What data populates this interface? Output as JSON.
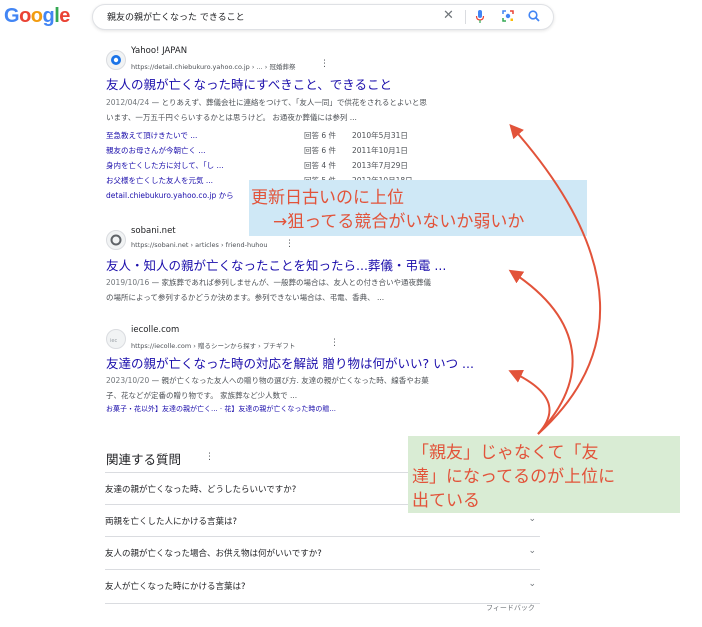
{
  "header": {
    "query": "親友の親が亡くなった できること"
  },
  "results": [
    {
      "site": "Yahoo! JAPAN",
      "url": "https://detail.chiebukuro.yahoo.co.jp › ... › 冠婚葬祭",
      "title": "友人の親が亡くなった時にすべきこと、できること",
      "date": "2012/04/24",
      "snippet1": " — とりあえず、葬儀会社に連絡をつけて、「友人一同」で供花をされるとよいと思",
      "snippet2": "います、一万五千円ぐらいするかとは思うけど。 お通夜か葬儀には参列 ...",
      "sub": [
        {
          "label": "至急教えて頂けきたいで ...",
          "count": "回答 6 件",
          "date": "2010年5月31日"
        },
        {
          "label": "親友のお母さんが今朝亡く ...",
          "count": "回答 6 件",
          "date": "2011年10月1日"
        },
        {
          "label": "身内を亡くした方に対して、「し ...",
          "count": "回答 4 件",
          "date": "2013年7月29日"
        },
        {
          "label": "お父様を亡くした友人を元気 ...",
          "count": "回答 5 件",
          "date": "2012年10月18日"
        }
      ],
      "more": "detail.chiebukuro.yahoo.co.jp から"
    },
    {
      "site": "sobani.net",
      "url": "https://sobani.net › articles › friend-huhou",
      "title": "友人・知人の親が亡くなったことを知ったら...葬儀・弔電 ...",
      "date": "2019/10/16",
      "snippet1": " — 家族葬であれば参列しませんが、一般葬の場合は、友人との付き合いや通夜葬儀",
      "snippet2": "の場所によって参列するかどうか決めます。参列できない場合は、弔電、香典、 ..."
    },
    {
      "site": "iecolle.com",
      "url": "https://iecolle.com › 贈るシーンから探す › プチギフト",
      "title": "友達の親が亡くなった時の対応を解説 贈り物は何がいい? いつ ...",
      "date": "2023/10/20",
      "snippet1": " — 親が亡くなった友人への贈り物の選び方. 友達の親が亡くなった時、線香やお菓",
      "snippet2": "子、花などが定番の贈り物です。 家族葬など少人数で ...",
      "links": "お菓子・花以外】友達の親が亡く... · 花】友達の親が亡くなった時の贈..."
    }
  ],
  "paa": {
    "title": "関連する質問",
    "questions": [
      "友達の親が亡くなった時、どうしたらいいですか?",
      "両親を亡くした人にかける言葉は?",
      "友人の親が亡くなった場合、お供え物は何がいいですか?",
      "友人が亡くなった時にかける言葉は?"
    ],
    "feedback": "フィードバック"
  },
  "annotations": {
    "blue_line1": "更新日古いのに上位",
    "blue_line2": "→狙ってる競合がいないか弱いか",
    "green_line1": "「親友」じゃなくて「友",
    "green_line2": "達」になってるのが上位に",
    "green_line3": "出ている"
  },
  "colors": {
    "link": "#1a0dab",
    "annotation_text": "#e2533a",
    "annotation_blue_bg": "#cfe8f6",
    "annotation_green_bg": "#d9ecd4"
  }
}
